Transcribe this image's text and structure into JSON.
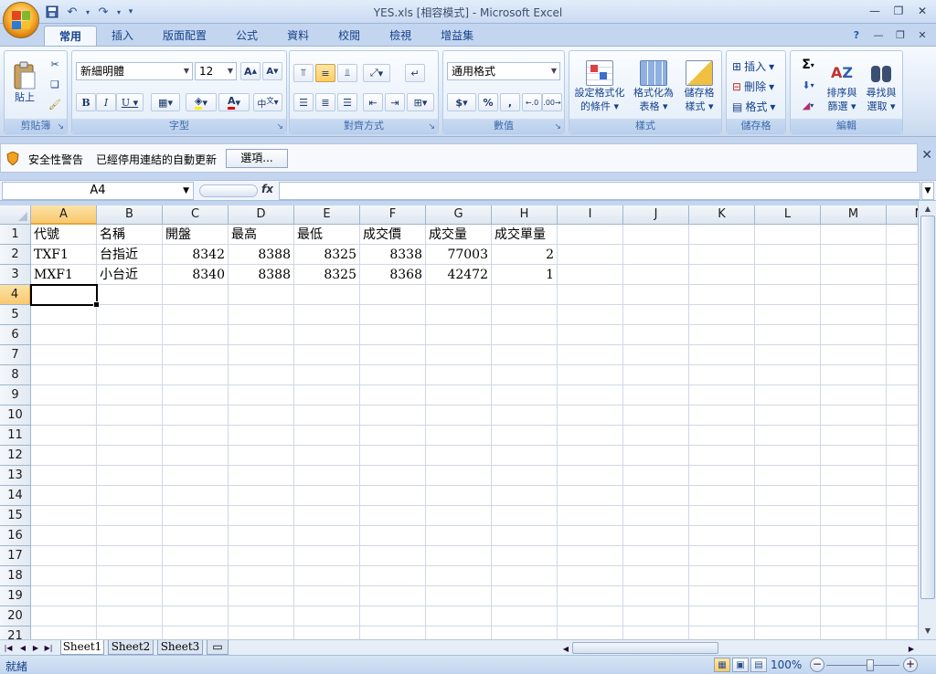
{
  "window": {
    "title": "YES.xls [相容模式] - Microsoft Excel"
  },
  "tabs": [
    "常用",
    "插入",
    "版面配置",
    "公式",
    "資料",
    "校閱",
    "檢視",
    "增益集"
  ],
  "ribbon": {
    "clipboard": {
      "label": "剪貼簿",
      "paste": "貼上"
    },
    "font": {
      "label": "字型",
      "name": "新細明體",
      "size": "12"
    },
    "alignment": {
      "label": "對齊方式"
    },
    "number": {
      "label": "數值",
      "format": "通用格式",
      "currency": "$",
      "percent": "%",
      "comma": ","
    },
    "styles": {
      "label": "樣式",
      "conditional": [
        "設定格式化",
        "的條件"
      ],
      "as_table": [
        "格式化為",
        "表格"
      ],
      "cell_styles": [
        "儲存格",
        "樣式"
      ]
    },
    "cells": {
      "label": "儲存格",
      "insert": "插入",
      "delete": "刪除",
      "format": "格式"
    },
    "editing": {
      "label": "編輯",
      "sort": [
        "排序與",
        "篩選"
      ],
      "find": [
        "尋找與",
        "選取"
      ],
      "sigma": "Σ"
    }
  },
  "security": {
    "title": "安全性警告",
    "message": "已經停用連結的自動更新",
    "options_button": "選項..."
  },
  "formula_bar": {
    "name_box": "A4",
    "fx": "fx",
    "value": ""
  },
  "sheet": {
    "columns": [
      "A",
      "B",
      "C",
      "D",
      "E",
      "F",
      "G",
      "H",
      "I",
      "J",
      "K",
      "L",
      "M",
      "N"
    ],
    "rows": [
      "1",
      "2",
      "3",
      "4",
      "5",
      "6",
      "7",
      "8",
      "9",
      "10",
      "11",
      "12",
      "13",
      "14",
      "15",
      "16",
      "17",
      "18",
      "19",
      "20",
      "21"
    ],
    "selected_column": "A",
    "selected_row": "4",
    "data": [
      [
        "代號",
        "名稱",
        "開盤",
        "最高",
        "最低",
        "成交價",
        "成交量",
        "成交單量"
      ],
      [
        "TXF1",
        "台指近",
        "8342",
        "8388",
        "8325",
        "8338",
        "77003",
        "2"
      ],
      [
        "MXF1",
        "小台近",
        "8340",
        "8388",
        "8325",
        "8368",
        "42472",
        "1"
      ]
    ]
  },
  "sheet_tabs": [
    "Sheet1",
    "Sheet2",
    "Sheet3"
  ],
  "status": {
    "text": "就緒",
    "zoom": "100%"
  }
}
